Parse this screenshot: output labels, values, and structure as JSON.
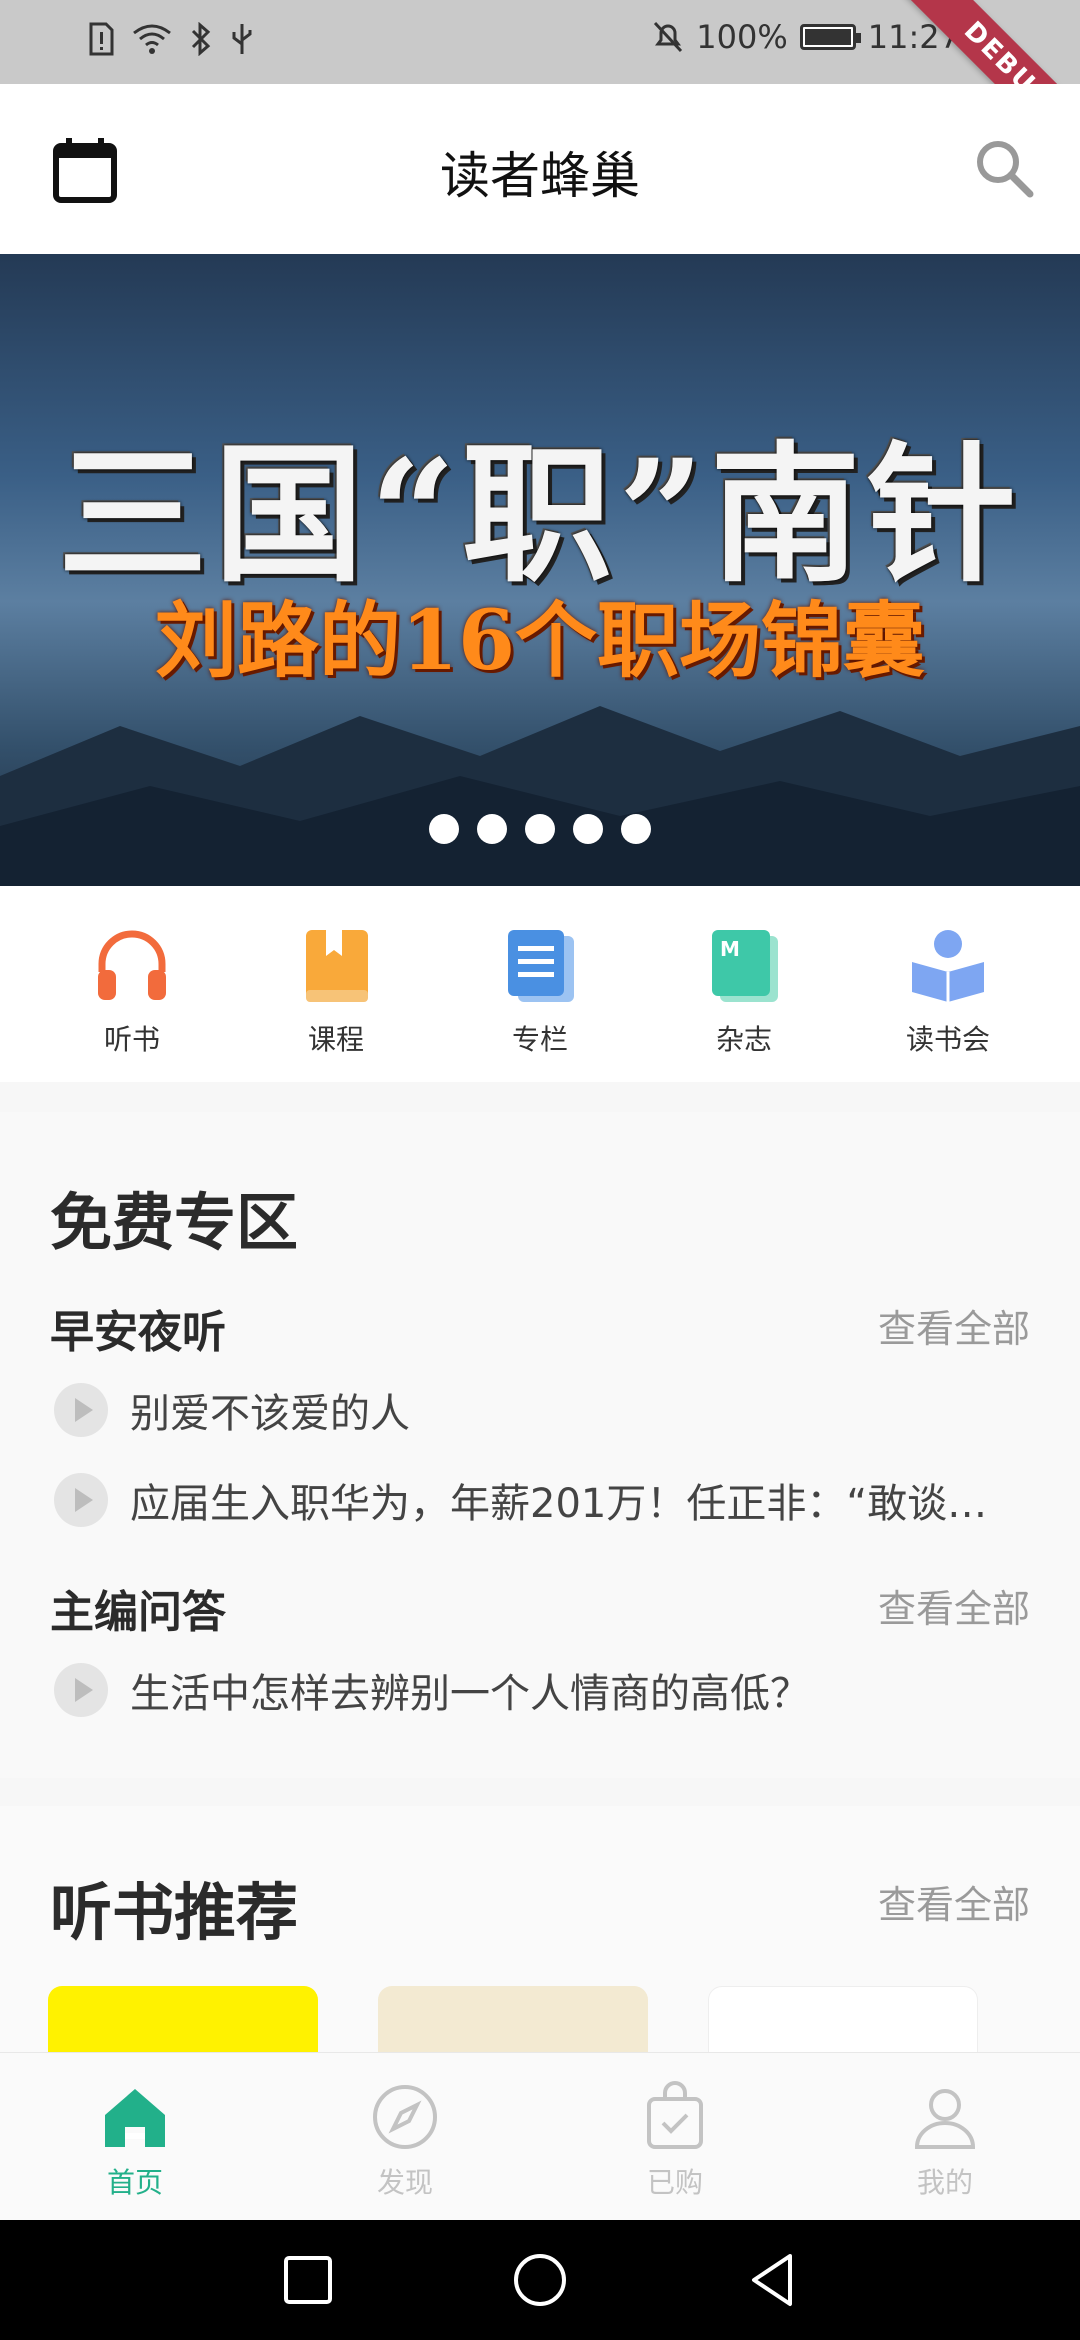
{
  "status_bar": {
    "battery": "100%",
    "time": "11:27",
    "debug": "DEBUG"
  },
  "app_bar": {
    "title": "读者蜂巢"
  },
  "banner": {
    "line1": "三国“职”南针",
    "line2": "刘路的16个职场锦囊",
    "dot_count": 5
  },
  "categories": [
    {
      "label": "听书",
      "icon": "headphones-icon",
      "color": "#f26b3c"
    },
    {
      "label": "课程",
      "icon": "course-book-icon",
      "color": "#f9a93a"
    },
    {
      "label": "专栏",
      "icon": "column-doc-icon",
      "color": "#4a90e2"
    },
    {
      "label": "杂志",
      "icon": "magazine-icon",
      "color": "#3ec8a8"
    },
    {
      "label": "读书会",
      "icon": "reading-club-icon",
      "color": "#7ea6f2"
    }
  ],
  "free_zone": {
    "title": "免费专区",
    "groups": [
      {
        "title": "早安夜听",
        "see_all": "查看全部",
        "tracks": [
          "别爱不该爱的人",
          "应届生入职华为，年薪201万！任正非：“敢谈…"
        ]
      },
      {
        "title": "主编问答",
        "see_all": "查看全部",
        "tracks": [
          "生活中怎样去辨别一个人情商的高低？"
        ]
      }
    ]
  },
  "listen_recommend": {
    "title": "听书推荐",
    "see_all": "查看全部"
  },
  "bottom_nav": [
    {
      "label": "首页",
      "icon": "home-icon",
      "active": true
    },
    {
      "label": "发现",
      "icon": "compass-icon",
      "active": false
    },
    {
      "label": "已购",
      "icon": "purchased-bag-icon",
      "active": false
    },
    {
      "label": "我的",
      "icon": "profile-icon",
      "active": false
    }
  ],
  "colors": {
    "accent": "#22b08a",
    "inactive": "#c3c3c3"
  }
}
